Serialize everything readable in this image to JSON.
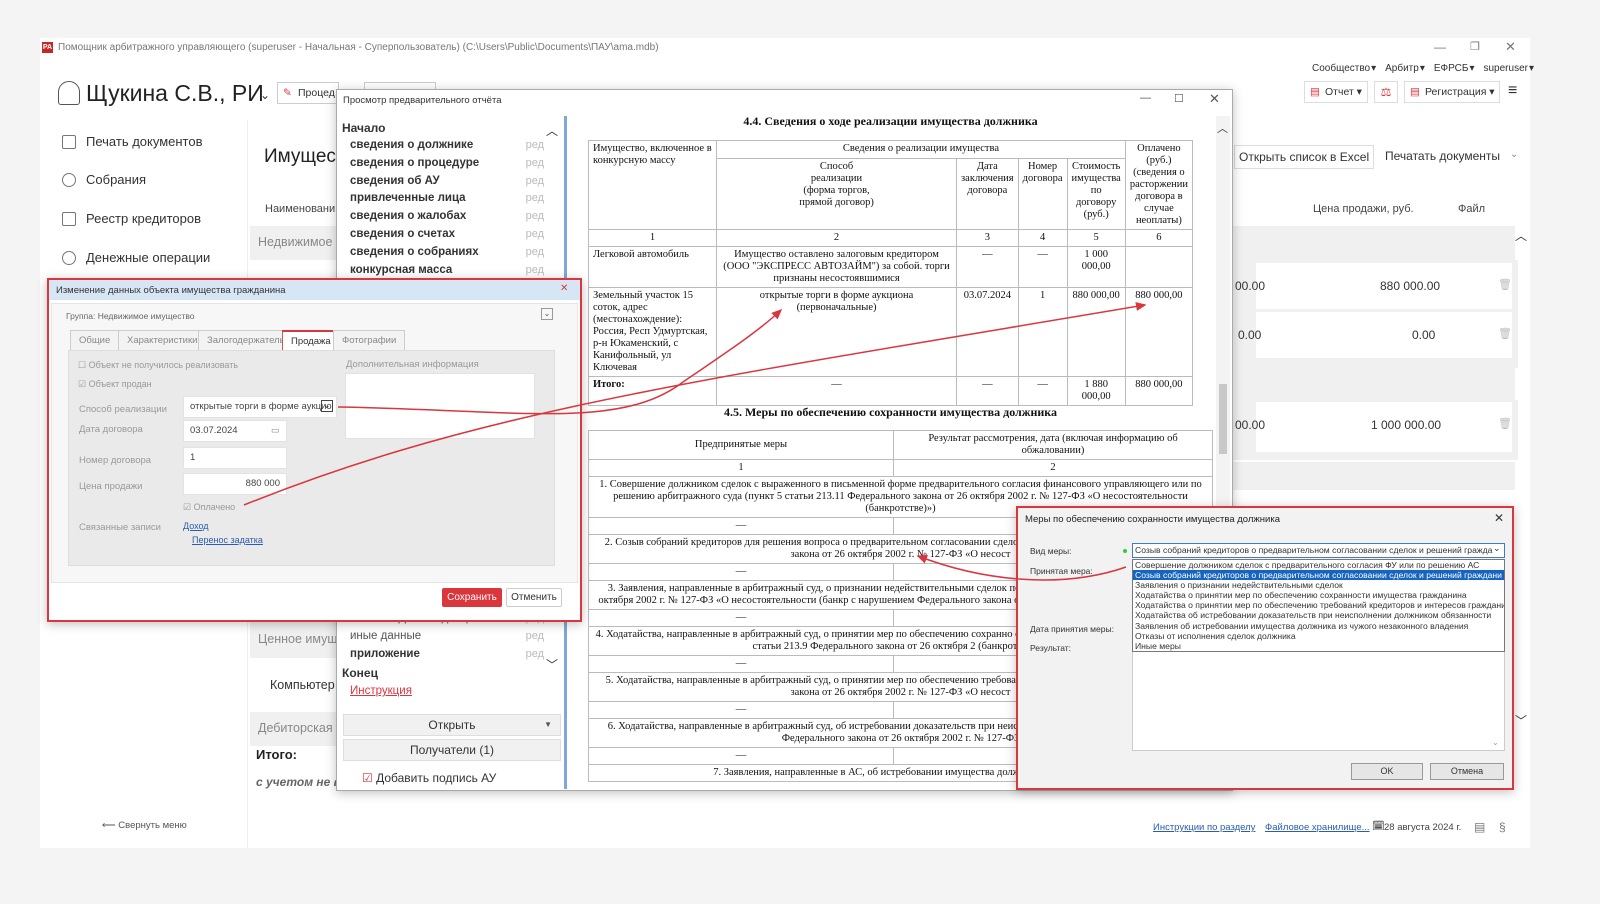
{
  "app": {
    "title": "Помощник арбитражного управляющего (superuser - Начальная - Суперпользователь) (C:\\Users\\Public\\Documents\\ПАУ\\ama.mdb)",
    "user_name": "Щукина С.В., РИ",
    "procedure_button": "Процед",
    "top_menu": [
      "Сообщество",
      "Арбитр",
      "ЕФРСБ",
      "superuser"
    ],
    "toolbar": {
      "report": "Отчет",
      "registration": "Регистрация"
    },
    "sidebar": [
      {
        "label": "Печать документов",
        "icon": "print-icon"
      },
      {
        "label": "Собрания",
        "icon": "meeting-icon"
      },
      {
        "label": "Реестр кредиторов",
        "icon": "registry-icon"
      },
      {
        "label": "Денежные операции",
        "icon": "money-icon"
      }
    ],
    "collapse_menu": "Свернуть меню",
    "main": {
      "title": "Имущест",
      "col_name": "Наименовани",
      "group_realty": "Недвижимое",
      "group_valuable": "Ценное имущ",
      "computer_row": "Компьютер",
      "group_debt": "Дебиторская",
      "total_label": "Итого:",
      "note": "с учетом не в",
      "open_excel": "Открыть список в Excel",
      "print_docs": "Печатать документы",
      "col_price": "Цена продажи, руб.",
      "col_file": "Файл",
      "rows": [
        {
          "left": "00.00",
          "price": "880 000.00"
        },
        {
          "left": "0.00",
          "price": "0.00"
        },
        {
          "left": "00.00",
          "price": "1 000 000.00"
        }
      ]
    },
    "footer": {
      "instructions": "Инструкции по разделу",
      "storage": "Файловое хранилище...",
      "date": "28 августа 2024 г."
    }
  },
  "preview": {
    "title": "Просмотр предварительного отчёта",
    "start": "Начало",
    "end": "Конец",
    "edit": "ред",
    "sections": [
      "сведения о должнике",
      "сведения о процедуре",
      "сведения об АУ",
      "привлеченные лица",
      "сведения о жалобах",
      "сведения о счетах",
      "сведения о собраниях",
      "конкурсная масса"
    ],
    "sections_bottom": [
      {
        "label": "исх/вх корреспонденция",
        "bold": false
      },
      {
        "label": "иные данные",
        "bold": false
      },
      {
        "label": "приложение",
        "bold": true
      }
    ],
    "instruction": "Инструкция",
    "open_button": "Открыть",
    "recipients_button": "Получатели (1)",
    "add_signature": "Добавить подпись АУ"
  },
  "report": {
    "h44": "4.4. Сведения о ходе реализации имущества должника",
    "t44_head": {
      "c1": "Имущество, включенное в конкурсную массу",
      "sale_info": "Сведения о реализации имущества",
      "c2": "Способ реализации (форма торгов, прямой договор)",
      "c3": "Дата заключения договора",
      "c4": "Номер договора",
      "c5": "Стоимость имущества по договору (руб.)",
      "c6": "Оплачено (руб.) (сведения о расторжении договора в случае неоплаты)"
    },
    "t44_nums": [
      "1",
      "2",
      "3",
      "4",
      "5",
      "6"
    ],
    "t44_rows": [
      [
        "Легковой автомобиль",
        "Имущество оставлено залоговым кредитором (ООО \"ЭКСПРЕСС АВТОЗАЙМ\") за собой. торги признаны несостоявшимися",
        "—",
        "—",
        "1 000 000,00",
        ""
      ],
      [
        "Земельный участок 15 соток, адрес (местонахождение): Россия, Респ Удмуртская, р-н Юкаменский, с Канифольный, ул Ключевая",
        "открытые торги в форме аукциона (первоначальные)",
        "03.07.2024",
        "1",
        "880 000,00",
        "880 000,00"
      ],
      [
        "Итого:",
        "—",
        "—",
        "—",
        "1 880 000,00",
        "880 000,00"
      ]
    ],
    "h45": "4.5. Меры по обеспечению сохранности имущества должника",
    "t45_head": [
      "Предпринятые меры",
      "Результат рассмотрения, дата (включая информацию об обжаловании)"
    ],
    "t45_nums": [
      "1",
      "2"
    ],
    "dash": "—",
    "t45_rows": [
      "1. Совершение должником сделок с выраженного в письменной форме предварительного согласия финансового управляющего или по решению арбитражного суда (пункт 5 статьи 213.11 Федерального закона от 26 октября 2002 г. № 127-ФЗ «О несостоятельности (банкротстве)»)",
      "2. Созыв собраний кредиторов для решения вопроса о предварительном согласовании сделок и пункта 7 статьи 213.9 Федерального закона от 26 октября 2002 г. № 127-ФЗ «О несост",
      "3. Заявления, направленные в арбитражный суд, о признании недействительными сделок по 61.2 и 61.3 Федерального закона от 26 октября 2002 г. № 127-ФЗ «О несостоятельности (банкр с нарушением Федерального закона от 26 октября 2002 г. № 127-ФЗ «О несост",
      "4. Ходатайства, направленные в арбитражный суд, о принятии мер по обеспечению сохранно отмене таких мер (абзац восьмой пункта 7 статьи 213.9 Федерального закона от 26 октября 2 (банкротстве)»)",
      "5. Ходатайства, направленные в арбитражный суд, о принятии мер по обеспечению требовани (пункт 3 статьи 213.11 Федерального закона от 26 октября 2002 г. № 127-ФЗ «О несост",
      "6. Ходатайства, направленные в арбитражный суд, об истребовании доказательств при неис установленной пунктом 9 статьи 213.9 Федерального закона от 26 октября 2002 г. № 127-ФЗ",
      "7. Заявления, направленные в АС, об истребовании имущества должника из чужого"
    ]
  },
  "edit_dialog": {
    "title": "Изменение данных объекта имущества гражданина",
    "group_label": "Группа:",
    "group_value": "Недвижимое имущество",
    "tabs": [
      "Общие",
      "Характеристики",
      "Залогодержатель",
      "Продажа",
      "Фотографии"
    ],
    "active_tab": "Продажа",
    "not_realized": "Объект не получилось реализовать",
    "sold": "Объект продан",
    "method_label": "Способ реализации",
    "method_value": "открытые торги в форме аукцио",
    "date_label": "Дата договора",
    "date_value": "03.07.2024",
    "number_label": "Номер договора",
    "number_value": "1",
    "price_label": "Цена продажи",
    "price_value": "880 000",
    "paid": "Оплачено",
    "related_label": "Связанные записи",
    "related_links": [
      "Доход",
      "Перенос задатка"
    ],
    "extra_label": "Дополнительная информация",
    "save": "Сохранить",
    "cancel": "Отменить"
  },
  "measures_dialog": {
    "title": "Меры по обеспечению сохранности имущества должника",
    "type_label": "Вид меры:",
    "measure_label": "Принятая мера:",
    "date_label": "Дата принятия меры:",
    "result_label": "Результат:",
    "selected": "Созыв собраний кредиторов о предварительном согласовании сделок и решений гражда",
    "options": [
      "Совершение должником сделок с предварительного согласия ФУ или по решению АС",
      "Созыв собраний кредиторов о предварительном согласовании сделок и решений граждани",
      "Заявления о признании недействительными сделок",
      "Ходатайства о принятии мер по обеспечению сохранности имущества гражданина",
      "Ходатайства о принятии мер по обеспечению требований кредиторов и интересов граждани",
      "Ходатайства об истребовании доказательств при неисполнении должником обязанности",
      "Заявления об истребовании имущества должника из чужого незаконного владения",
      "Отказы от исполнения сделок должника",
      "Иные меры"
    ],
    "ok": "OK",
    "cancel": "Отмена"
  },
  "colors": {
    "accent_red": "#d9363e",
    "link": "#2a5db0",
    "selection": "#1565c0"
  }
}
